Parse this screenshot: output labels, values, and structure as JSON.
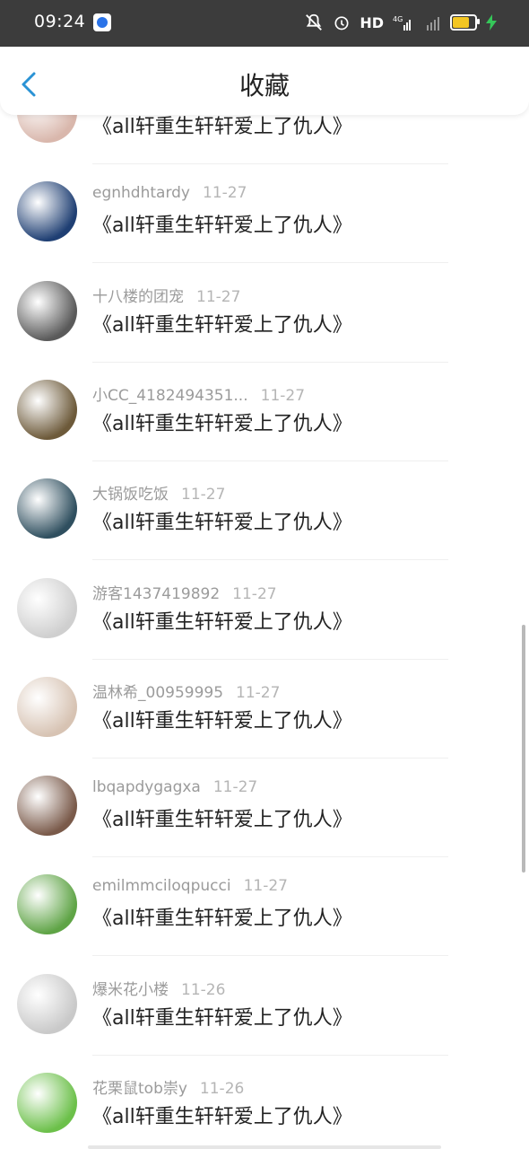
{
  "status_bar": {
    "time": "09:24",
    "network": "4G",
    "hd_label": "HD",
    "icons": [
      "baidu-app-icon",
      "mute-bell-icon",
      "alarm-icon",
      "signal-icon",
      "battery-icon",
      "charging-bolt-icon"
    ]
  },
  "header": {
    "title": "收藏",
    "back_icon": "chevron-left-icon",
    "accent_color": "#2a93d5"
  },
  "items": [
    {
      "user": "",
      "date": "",
      "text": "《all轩重生轩轩爱上了仇人》",
      "avatar_color": "#d9b7ac"
    },
    {
      "user": "egnhdhtardy",
      "date": "11-27",
      "text": "《all轩重生轩轩爱上了仇人》",
      "avatar_color": "#1f3f73"
    },
    {
      "user": "十八楼的团宠",
      "date": "11-27",
      "text": "《all轩重生轩轩爱上了仇人》",
      "avatar_color": "#5a5a5a"
    },
    {
      "user": "小CC_4182494351...",
      "date": "11-27",
      "text": "《all轩重生轩轩爱上了仇人》",
      "avatar_color": "#6d5a3a"
    },
    {
      "user": "大锅饭吃饭",
      "date": "11-27",
      "text": "《all轩重生轩轩爱上了仇人》",
      "avatar_color": "#2f4f5f"
    },
    {
      "user": "游客1437419892",
      "date": "11-27",
      "text": "《all轩重生轩轩爱上了仇人》",
      "avatar_color": "#cfcfcf"
    },
    {
      "user": "温林希_00959995",
      "date": "11-27",
      "text": "《all轩重生轩轩爱上了仇人》",
      "avatar_color": "#d7c3b3"
    },
    {
      "user": "lbqapdygagxa",
      "date": "11-27",
      "text": "《all轩重生轩轩爱上了仇人》",
      "avatar_color": "#7a5a4a"
    },
    {
      "user": "emilmmciloqpucci",
      "date": "11-27",
      "text": "《all轩重生轩轩爱上了仇人》",
      "avatar_color": "#5fa446"
    },
    {
      "user": "爆米花小楼",
      "date": "11-26",
      "text": "《all轩重生轩轩爱上了仇人》",
      "avatar_color": "#c9c9c9"
    },
    {
      "user": "花栗鼠tob崇y",
      "date": "11-26",
      "text": "《all轩重生轩轩爱上了仇人》",
      "avatar_color": "#6cc04a"
    }
  ]
}
